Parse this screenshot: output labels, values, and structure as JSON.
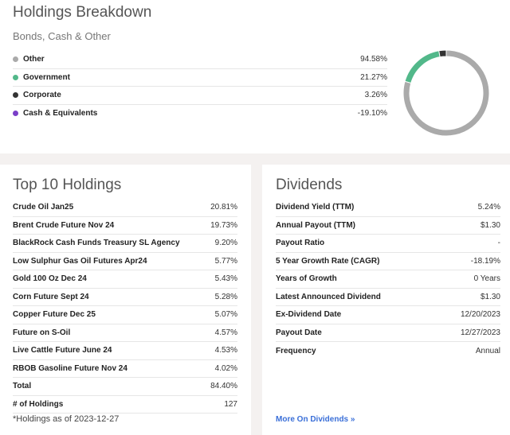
{
  "breakdown": {
    "title": "Holdings Breakdown",
    "subtitle": "Bonds, Cash & Other",
    "items": [
      {
        "label": "Other",
        "value": "94.58%",
        "pct": 94.58,
        "color": "#aaaaaa"
      },
      {
        "label": "Government",
        "value": "21.27%",
        "pct": 21.27,
        "color": "#52b88a"
      },
      {
        "label": "Corporate",
        "value": "3.26%",
        "pct": 3.26,
        "color": "#333333"
      },
      {
        "label": "Cash & Equivalents",
        "value": "-19.10%",
        "pct": -19.1,
        "color": "#7a3fc8"
      }
    ]
  },
  "holdings": {
    "title": "Top 10 Holdings",
    "rows": [
      {
        "name": "Crude Oil Jan25",
        "value": "20.81%"
      },
      {
        "name": "Brent Crude Future Nov 24",
        "value": "19.73%"
      },
      {
        "name": "BlackRock Cash Funds Treasury SL Agency",
        "value": "9.20%"
      },
      {
        "name": "Low Sulphur Gas Oil Futures Apr24",
        "value": "5.77%"
      },
      {
        "name": "Gold 100 Oz Dec 24",
        "value": "5.43%"
      },
      {
        "name": "Corn Future Sept 24",
        "value": "5.28%"
      },
      {
        "name": "Copper Future Dec 25",
        "value": "5.07%"
      },
      {
        "name": "Future on S-Oil",
        "value": "4.57%"
      },
      {
        "name": "Live Cattle Future June 24",
        "value": "4.53%"
      },
      {
        "name": "RBOB Gasoline Future Nov 24",
        "value": "4.02%"
      },
      {
        "name": "Total",
        "value": "84.40%"
      },
      {
        "name": "# of Holdings",
        "value": "127"
      }
    ],
    "note": "*Holdings as of 2023-12-27"
  },
  "dividends": {
    "title": "Dividends",
    "rows": [
      {
        "name": "Dividend Yield (TTM)",
        "value": "5.24%"
      },
      {
        "name": "Annual Payout (TTM)",
        "value": "$1.30"
      },
      {
        "name": "Payout Ratio",
        "value": "-"
      },
      {
        "name": "5 Year Growth Rate (CAGR)",
        "value": "-18.19%"
      },
      {
        "name": "Years of Growth",
        "value": "0 Years"
      },
      {
        "name": "Latest Announced Dividend",
        "value": "$1.30"
      },
      {
        "name": "Ex-Dividend Date",
        "value": "12/20/2023"
      },
      {
        "name": "Payout Date",
        "value": "12/27/2023"
      },
      {
        "name": "Frequency",
        "value": "Annual"
      }
    ],
    "more_link": "More On Dividends »"
  }
}
